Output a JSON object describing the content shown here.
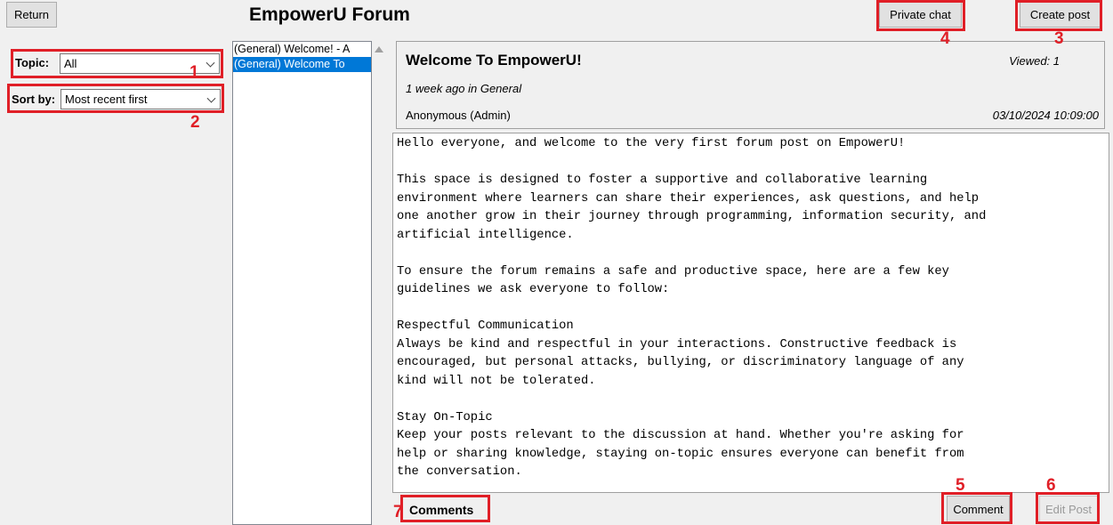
{
  "toolbar": {
    "return_label": "Return",
    "app_title": "EmpowerU Forum",
    "private_chat_label": "Private chat",
    "create_post_label": "Create post"
  },
  "filters": {
    "topic_label": "Topic:",
    "topic_value": "All",
    "sort_label": "Sort by:",
    "sort_value": "Most recent first"
  },
  "posts": [
    {
      "label": "(General) Welcome! - A"
    },
    {
      "label": "(General) Welcome To"
    }
  ],
  "post": {
    "title": "Welcome To EmpowerU!",
    "views": "Viewed: 1",
    "meta": "1 week ago in General",
    "author": "Anonymous (Admin)",
    "date": "03/10/2024 10:09:00",
    "paragraphs": [
      "Hello everyone, and welcome to the very first forum post on EmpowerU!",
      "This space is designed to foster a supportive and collaborative learning\nenvironment where learners can share their experiences, ask questions, and help\none another grow in their journey through programming, information security, and\nartificial intelligence.",
      "To ensure the forum remains a safe and productive space, here are a few key\nguidelines we ask everyone to follow:",
      "Respectful Communication\nAlways be kind and respectful in your interactions. Constructive feedback is\nencouraged, but personal attacks, bullying, or discriminatory language of any\nkind will not be tolerated.",
      "Stay On-Topic\nKeep your posts relevant to the discussion at hand. Whether you're asking for\nhelp or sharing knowledge, staying on-topic ensures everyone can benefit from\nthe conversation."
    ]
  },
  "footer": {
    "comments_label": "Comments",
    "comment_button_label": "Comment",
    "edit_post_label": "Edit Post"
  },
  "annotations": [
    "1",
    "2",
    "3",
    "4",
    "5",
    "6",
    "7"
  ],
  "colors": {
    "annotation": "#e01f27",
    "selection": "#0078d7"
  }
}
